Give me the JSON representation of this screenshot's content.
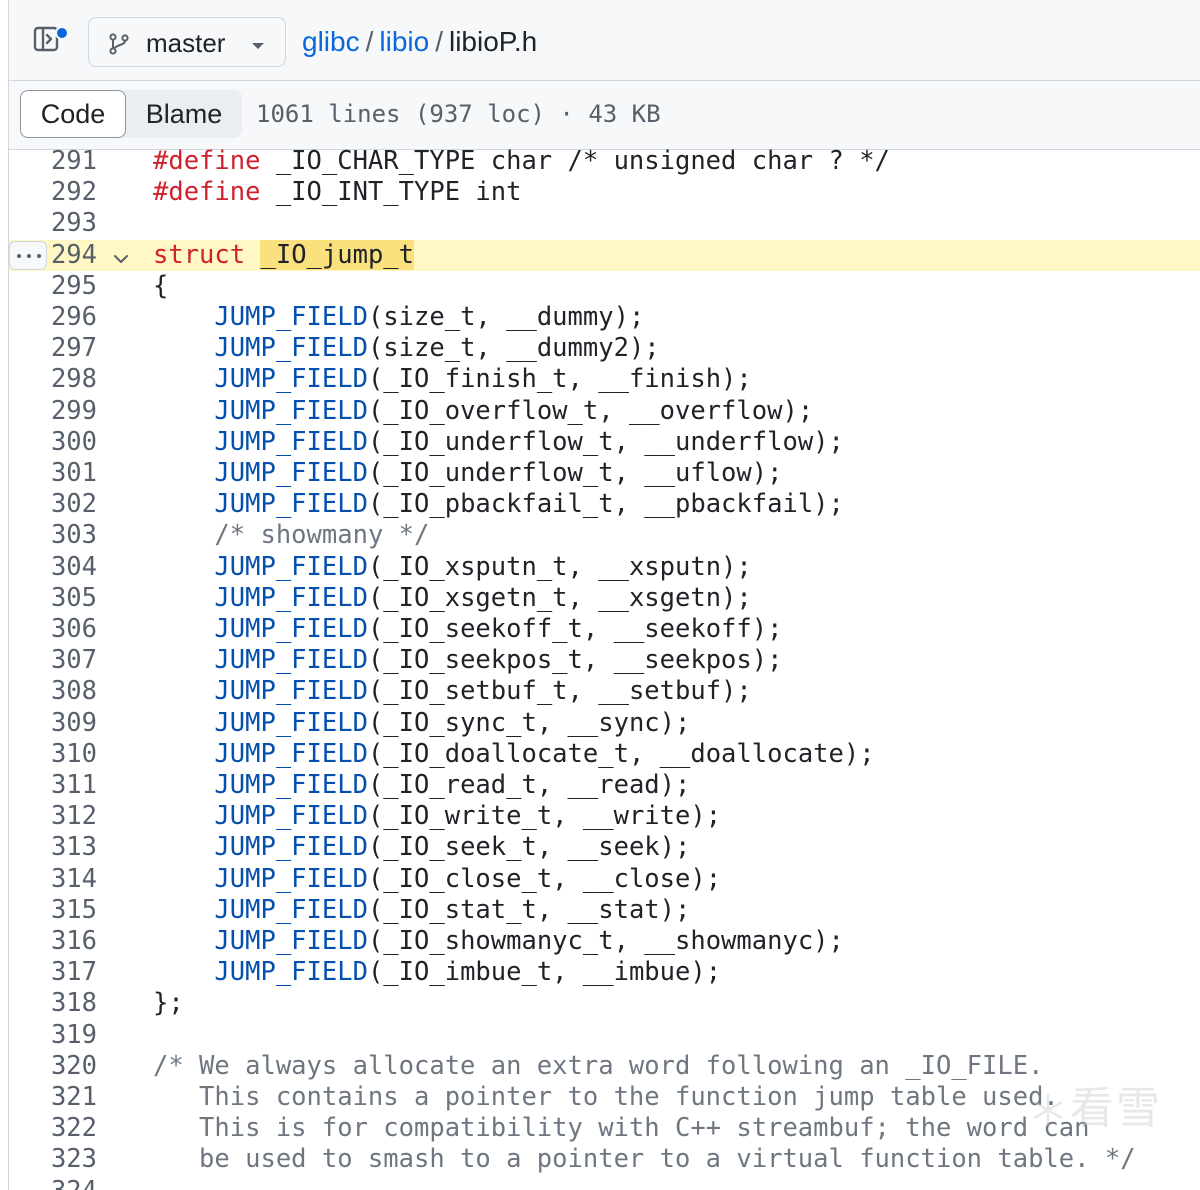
{
  "header": {
    "branch": "master",
    "breadcrumb": {
      "repo": "glibc",
      "folder": "libio",
      "file": "libioP.h",
      "separator": "/"
    }
  },
  "toolbar": {
    "tab_code": "Code",
    "tab_blame": "Blame",
    "file_info": "1061 lines (937 loc) · 43 KB"
  },
  "code": {
    "highlighted_line": 294,
    "lines": [
      {
        "n": "291",
        "tokens": [
          {
            "t": "#define",
            "c": "kw"
          },
          {
            "t": " _IO_CHAR_TYPE char /* unsigned char ? */",
            "c": "plain"
          }
        ]
      },
      {
        "n": "292",
        "tokens": [
          {
            "t": "#define",
            "c": "kw"
          },
          {
            "t": " _IO_INT_TYPE int",
            "c": "plain"
          }
        ]
      },
      {
        "n": "293",
        "tokens": []
      },
      {
        "n": "294",
        "tokens": [
          {
            "t": "struct",
            "c": "kw"
          },
          {
            "t": " ",
            "c": "plain"
          },
          {
            "t": "_IO_jump_t",
            "c": "mark"
          }
        ]
      },
      {
        "n": "295",
        "tokens": [
          {
            "t": "{",
            "c": "plain"
          }
        ]
      },
      {
        "n": "296",
        "tokens": [
          {
            "t": "    ",
            "c": "plain"
          },
          {
            "t": "JUMP_FIELD",
            "c": "fn"
          },
          {
            "t": "(size_t, __dummy);",
            "c": "plain"
          }
        ]
      },
      {
        "n": "297",
        "tokens": [
          {
            "t": "    ",
            "c": "plain"
          },
          {
            "t": "JUMP_FIELD",
            "c": "fn"
          },
          {
            "t": "(size_t, __dummy2);",
            "c": "plain"
          }
        ]
      },
      {
        "n": "298",
        "tokens": [
          {
            "t": "    ",
            "c": "plain"
          },
          {
            "t": "JUMP_FIELD",
            "c": "fn"
          },
          {
            "t": "(_IO_finish_t, __finish);",
            "c": "plain"
          }
        ]
      },
      {
        "n": "299",
        "tokens": [
          {
            "t": "    ",
            "c": "plain"
          },
          {
            "t": "JUMP_FIELD",
            "c": "fn"
          },
          {
            "t": "(_IO_overflow_t, __overflow);",
            "c": "plain"
          }
        ]
      },
      {
        "n": "300",
        "tokens": [
          {
            "t": "    ",
            "c": "plain"
          },
          {
            "t": "JUMP_FIELD",
            "c": "fn"
          },
          {
            "t": "(_IO_underflow_t, __underflow);",
            "c": "plain"
          }
        ]
      },
      {
        "n": "301",
        "tokens": [
          {
            "t": "    ",
            "c": "plain"
          },
          {
            "t": "JUMP_FIELD",
            "c": "fn"
          },
          {
            "t": "(_IO_underflow_t, __uflow);",
            "c": "plain"
          }
        ]
      },
      {
        "n": "302",
        "tokens": [
          {
            "t": "    ",
            "c": "plain"
          },
          {
            "t": "JUMP_FIELD",
            "c": "fn"
          },
          {
            "t": "(_IO_pbackfail_t, __pbackfail);",
            "c": "plain"
          }
        ]
      },
      {
        "n": "303",
        "tokens": [
          {
            "t": "    ",
            "c": "plain"
          },
          {
            "t": "/* showmany */",
            "c": "cm"
          }
        ]
      },
      {
        "n": "304",
        "tokens": [
          {
            "t": "    ",
            "c": "plain"
          },
          {
            "t": "JUMP_FIELD",
            "c": "fn"
          },
          {
            "t": "(_IO_xsputn_t, __xsputn);",
            "c": "plain"
          }
        ]
      },
      {
        "n": "305",
        "tokens": [
          {
            "t": "    ",
            "c": "plain"
          },
          {
            "t": "JUMP_FIELD",
            "c": "fn"
          },
          {
            "t": "(_IO_xsgetn_t, __xsgetn);",
            "c": "plain"
          }
        ]
      },
      {
        "n": "306",
        "tokens": [
          {
            "t": "    ",
            "c": "plain"
          },
          {
            "t": "JUMP_FIELD",
            "c": "fn"
          },
          {
            "t": "(_IO_seekoff_t, __seekoff);",
            "c": "plain"
          }
        ]
      },
      {
        "n": "307",
        "tokens": [
          {
            "t": "    ",
            "c": "plain"
          },
          {
            "t": "JUMP_FIELD",
            "c": "fn"
          },
          {
            "t": "(_IO_seekpos_t, __seekpos);",
            "c": "plain"
          }
        ]
      },
      {
        "n": "308",
        "tokens": [
          {
            "t": "    ",
            "c": "plain"
          },
          {
            "t": "JUMP_FIELD",
            "c": "fn"
          },
          {
            "t": "(_IO_setbuf_t, __setbuf);",
            "c": "plain"
          }
        ]
      },
      {
        "n": "309",
        "tokens": [
          {
            "t": "    ",
            "c": "plain"
          },
          {
            "t": "JUMP_FIELD",
            "c": "fn"
          },
          {
            "t": "(_IO_sync_t, __sync);",
            "c": "plain"
          }
        ]
      },
      {
        "n": "310",
        "tokens": [
          {
            "t": "    ",
            "c": "plain"
          },
          {
            "t": "JUMP_FIELD",
            "c": "fn"
          },
          {
            "t": "(_IO_doallocate_t, __doallocate);",
            "c": "plain"
          }
        ]
      },
      {
        "n": "311",
        "tokens": [
          {
            "t": "    ",
            "c": "plain"
          },
          {
            "t": "JUMP_FIELD",
            "c": "fn"
          },
          {
            "t": "(_IO_read_t, __read);",
            "c": "plain"
          }
        ]
      },
      {
        "n": "312",
        "tokens": [
          {
            "t": "    ",
            "c": "plain"
          },
          {
            "t": "JUMP_FIELD",
            "c": "fn"
          },
          {
            "t": "(_IO_write_t, __write);",
            "c": "plain"
          }
        ]
      },
      {
        "n": "313",
        "tokens": [
          {
            "t": "    ",
            "c": "plain"
          },
          {
            "t": "JUMP_FIELD",
            "c": "fn"
          },
          {
            "t": "(_IO_seek_t, __seek);",
            "c": "plain"
          }
        ]
      },
      {
        "n": "314",
        "tokens": [
          {
            "t": "    ",
            "c": "plain"
          },
          {
            "t": "JUMP_FIELD",
            "c": "fn"
          },
          {
            "t": "(_IO_close_t, __close);",
            "c": "plain"
          }
        ]
      },
      {
        "n": "315",
        "tokens": [
          {
            "t": "    ",
            "c": "plain"
          },
          {
            "t": "JUMP_FIELD",
            "c": "fn"
          },
          {
            "t": "(_IO_stat_t, __stat);",
            "c": "plain"
          }
        ]
      },
      {
        "n": "316",
        "tokens": [
          {
            "t": "    ",
            "c": "plain"
          },
          {
            "t": "JUMP_FIELD",
            "c": "fn"
          },
          {
            "t": "(_IO_showmanyc_t, __showmanyc);",
            "c": "plain"
          }
        ]
      },
      {
        "n": "317",
        "tokens": [
          {
            "t": "    ",
            "c": "plain"
          },
          {
            "t": "JUMP_FIELD",
            "c": "fn"
          },
          {
            "t": "(_IO_imbue_t, __imbue);",
            "c": "plain"
          }
        ]
      },
      {
        "n": "318",
        "tokens": [
          {
            "t": "};",
            "c": "plain"
          }
        ]
      },
      {
        "n": "319",
        "tokens": []
      },
      {
        "n": "320",
        "tokens": [
          {
            "t": "/* We always allocate an extra word following an _IO_FILE.",
            "c": "cm"
          }
        ]
      },
      {
        "n": "321",
        "tokens": [
          {
            "t": "   This contains a pointer to the function jump table used.",
            "c": "cm"
          }
        ]
      },
      {
        "n": "322",
        "tokens": [
          {
            "t": "   This is for compatibility with C++ streambuf; the word can",
            "c": "cm"
          }
        ]
      },
      {
        "n": "323",
        "tokens": [
          {
            "t": "   be used to smash to a pointer to a virtual function table. */",
            "c": "cm"
          }
        ]
      },
      {
        "n": "324",
        "tokens": []
      }
    ]
  },
  "colors": {
    "link": "#0969da",
    "keyword": "#cf222e",
    "function": "#0550ae",
    "comment": "#6e7781",
    "highlight_row": "#fff8c5",
    "highlight_token": "#fae17d"
  },
  "icons": {
    "sidebar_toggle": "sidebar-expand-icon",
    "branch": "git-branch-icon",
    "caret": "triangle-down-icon",
    "fold": "chevron-down-icon",
    "more": "kebab-horizontal-icon"
  },
  "watermark": "看雪"
}
